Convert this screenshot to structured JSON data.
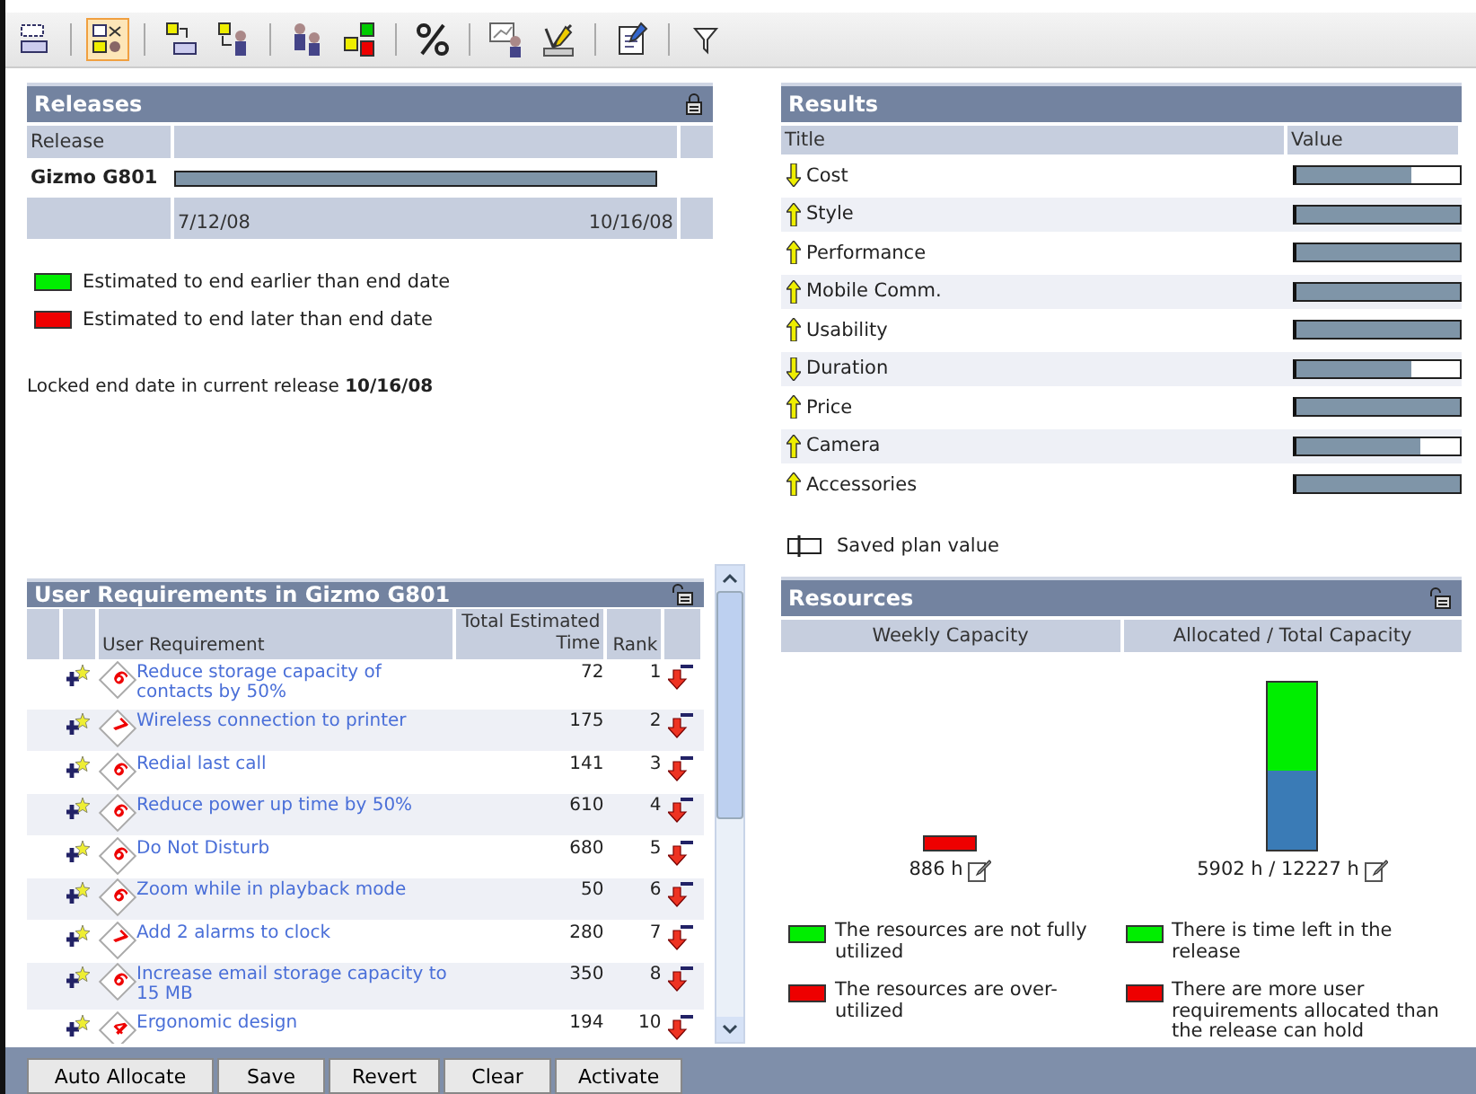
{
  "toolbar": [
    {
      "selected": false
    },
    {
      "selected": true
    },
    {
      "selected": false
    },
    {
      "selected": false
    },
    {
      "selected": false
    },
    {
      "selected": false
    },
    {
      "selected": false
    },
    {
      "selected": false
    },
    {
      "selected": false
    },
    {
      "selected": false
    },
    {
      "selected": false
    }
  ],
  "releases": {
    "title": "Releases",
    "column": "Release",
    "name": "Gizmo G801",
    "level": 1,
    "start": "7/12/08",
    "end": "10/16/08",
    "legend": [
      {
        "color": "#00ee00",
        "label": "Estimated to end earlier than end date"
      },
      {
        "color": "#ee0000",
        "label": "Estimated to end later than end date"
      }
    ],
    "locked": "Locked end date in current release **10/16/08**"
  },
  "results": {
    "title": "Results",
    "columns": [
      "Title",
      "Value"
    ],
    "rows": [
      {
        "kind": "down",
        "title": "Cost",
        "level": 0.7
      },
      {
        "kind": "up",
        "title": "Style",
        "level": 1
      },
      {
        "kind": "up",
        "title": "Performance",
        "level": 1
      },
      {
        "kind": "up",
        "title": "Mobile Comm.",
        "level": 1
      },
      {
        "kind": "up",
        "title": "Usability",
        "level": 1
      },
      {
        "kind": "down",
        "title": "Duration",
        "level": 0.7
      },
      {
        "kind": "up",
        "title": "Price",
        "level": 1
      },
      {
        "kind": "up",
        "title": "Camera",
        "level": 0.76
      },
      {
        "kind": "up",
        "title": "Accessories",
        "level": 1
      }
    ],
    "legend": "Saved plan value"
  },
  "requirements": {
    "title": "User Requirements in Gizmo G801",
    "columns": [
      "User Requirement",
      "Total Estimated Time",
      "Rank"
    ],
    "rows": [
      {
        "priority": "6",
        "name": "Reduce storage capacity of contacts by 50%",
        "time": "72",
        "rank": "1"
      },
      {
        "priority": "7",
        "name": "Wireless connection to printer",
        "time": "175",
        "rank": "2"
      },
      {
        "priority": "6",
        "name": "Redial last call",
        "time": "141",
        "rank": "3"
      },
      {
        "priority": "6",
        "name": "Reduce power up time by 50%",
        "time": "610",
        "rank": "4"
      },
      {
        "priority": "6",
        "name": "Do Not Disturb",
        "time": "680",
        "rank": "5"
      },
      {
        "priority": "6",
        "name": "Zoom while in playback mode",
        "time": "50",
        "rank": "6"
      },
      {
        "priority": "7",
        "name": "Add 2 alarms to clock",
        "time": "280",
        "rank": "7"
      },
      {
        "priority": "6",
        "name": "Increase email storage capacity to 15 MB",
        "time": "350",
        "rank": "8"
      },
      {
        "priority": "4",
        "name": "Ergonomic design",
        "time": "194",
        "rank": "10"
      }
    ]
  },
  "resources": {
    "title": "Resources",
    "columns": [
      "Weekly Capacity",
      "Allocated / Total Capacity"
    ],
    "weekly": {
      "over_utilized": true,
      "reading": "886 h"
    },
    "allocated": {
      "level": 0.48,
      "reading": "5902 h / 12227 h"
    },
    "legend": [
      {
        "color": "#00ee00",
        "label": "The resources are not fully utilized"
      },
      {
        "color": "#00ee00",
        "label": "There is time left in the release"
      },
      {
        "color": "#ee0000",
        "label": "The resources are over-utilized"
      },
      {
        "color": "#ee0000",
        "label": "There are more user requirements allocated than the release can hold"
      }
    ]
  },
  "buttons": [
    "Auto Allocate",
    "Save",
    "Revert",
    "Clear",
    "Activate"
  ]
}
